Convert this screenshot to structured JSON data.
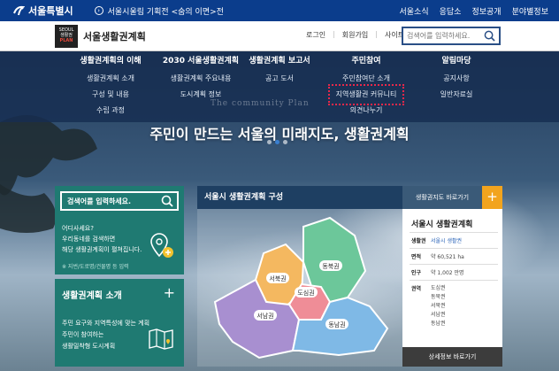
{
  "govbar": {
    "logo": "서울특별시",
    "news": "서울시울림 기획전 <숨의 이면>전",
    "links": [
      "서울소식",
      "응답소",
      "정보공개",
      "분야별정보"
    ]
  },
  "header": {
    "badge_line1": "SEOUL",
    "badge_line2": "생활권",
    "badge_line3": "PLAN",
    "site_name": "서울생활권계획",
    "links": [
      "로그인",
      "회원가입",
      "사이트맵"
    ],
    "search_placeholder": "검색어를 입력하세요."
  },
  "nav": [
    {
      "head": "생활권계획의 이해",
      "subs": [
        "생활권계획 소개",
        "구성 및 내용",
        "수립 과정"
      ]
    },
    {
      "head": "2030 서울생활권계획",
      "subs": [
        "생활권계획 주요내용",
        "도시계획 정보"
      ]
    },
    {
      "head": "생활권계획 보고서",
      "subs": [
        "공고 도서"
      ]
    },
    {
      "head": "주민참여",
      "subs": [
        "주민참여단 소개",
        "지역생활권 커뮤니티",
        "의견나누기"
      ]
    },
    {
      "head": "알림마당",
      "subs": [
        "공지사항",
        "일반자료실"
      ]
    }
  ],
  "hero": {
    "slogan_en": "The community Plan",
    "slogan": "주민이 만드는 서울의 미래지도, 생활권계획"
  },
  "left_box1": {
    "search_label": "검색어를 입력하세요.",
    "question_lines": [
      "어디사세요?",
      "우리동네를 검색하면",
      "해당 생활권계획이 펼쳐집니다."
    ],
    "hint": "※ 지번/도로명/건물명 등 입력"
  },
  "left_box2": {
    "title": "생활권계획 소개",
    "plus": "+",
    "desc_lines": [
      "주민 요구와 지역특성에 맞는 계획",
      "주민이 참여하는",
      "생활밀착형 도시계획"
    ]
  },
  "panel": {
    "title": "서울시 생활권계획 구성",
    "goto": "생활권지도 바로가기",
    "plus": "+",
    "regions": [
      "동북권",
      "서북권",
      "도심권",
      "서남권",
      "동남권"
    ]
  },
  "info": {
    "title": "서울시 생활권계획",
    "rows": [
      {
        "k": "생활권",
        "v": "서울시 생활권"
      },
      {
        "k": "면적",
        "v": "약 60,521 ha"
      },
      {
        "k": "인구",
        "v": "약 1,002 만명"
      }
    ],
    "regions_label": "권역",
    "regions": [
      "도심권",
      "동북권",
      "서북권",
      "서남권",
      "동남권"
    ],
    "more": "상세정보 바로가기"
  },
  "colors": {
    "govbar": "#0b3d8c",
    "green_box": "#1f7a72",
    "panel_title": "#1e3f62",
    "accent_orange": "#f2a41e",
    "region_dongbuk": "#6cc79a",
    "region_seobuk": "#f4b860",
    "region_dosim": "#ef8d97",
    "region_seonam": "#a88fd0",
    "region_dongnam": "#7fb9e6"
  }
}
